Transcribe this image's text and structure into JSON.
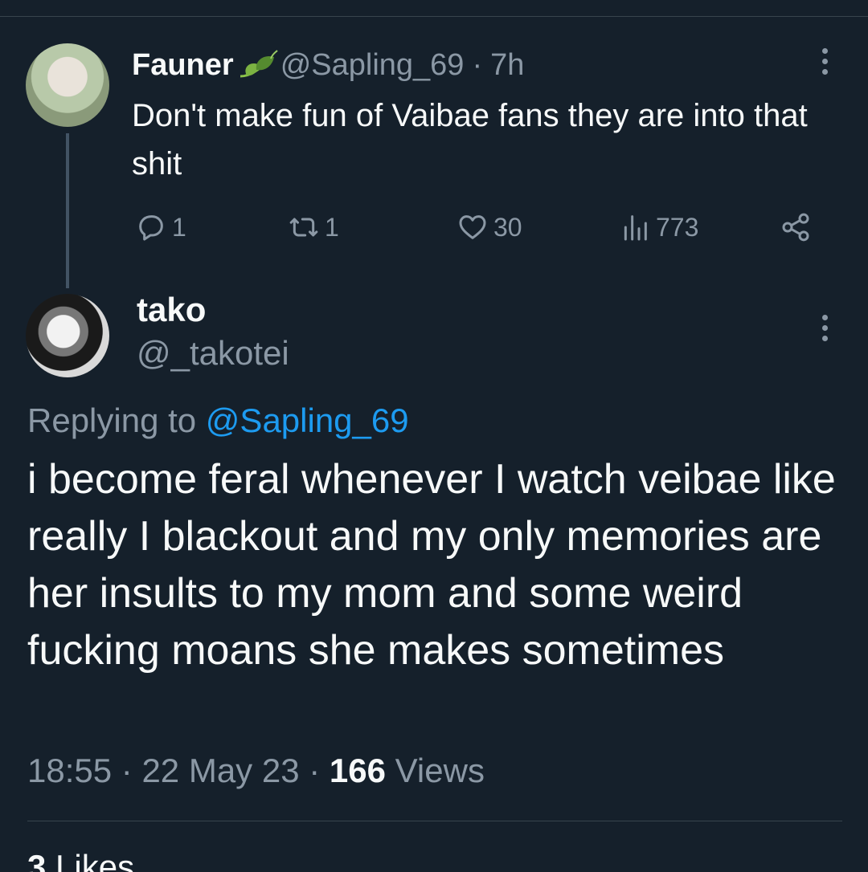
{
  "parent": {
    "display_name": "Fauner",
    "handle": "@Sapling_69",
    "separator": "·",
    "time": "7h",
    "text": "Don't make fun of Vaibae fans they are into that shit",
    "stats": {
      "replies": "1",
      "retweets": "1",
      "likes": "30",
      "views": "773"
    }
  },
  "reply": {
    "display_name": "tako",
    "handle": "@_takotei",
    "replying_prefix": "Replying to",
    "replying_mention": "@Sapling_69",
    "text": "i become feral whenever I watch veibae like really I blackout and my only memories are her insults to my mom and some weird fucking moans she makes sometimes",
    "time": "18:55",
    "date": "22 May 23",
    "separator": "·",
    "views_count": "166",
    "views_label": "Views"
  },
  "engagement": {
    "likes_count": "3",
    "likes_label": "Likes"
  },
  "colors": {
    "background": "#15202b",
    "text": "#f7f9f9",
    "muted": "#8b98a5",
    "accent": "#1d9bf0",
    "divider": "#38444d"
  }
}
